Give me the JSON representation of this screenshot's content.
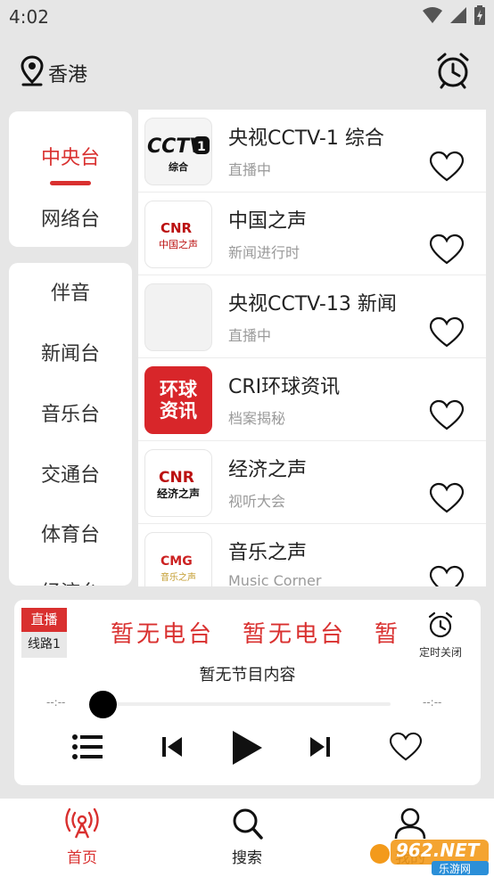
{
  "status_bar": {
    "time": "4:02"
  },
  "header": {
    "location": "香港"
  },
  "categories": {
    "group1": [
      {
        "label": "中央台",
        "active": true
      },
      {
        "label": "网络台",
        "active": false
      }
    ],
    "group2": [
      {
        "label": "伴音"
      },
      {
        "label": "新闻台"
      },
      {
        "label": "音乐台"
      },
      {
        "label": "交通台"
      },
      {
        "label": "体育台"
      },
      {
        "label": "经济台"
      }
    ]
  },
  "stations": [
    {
      "name": "央视CCTV-1 综合",
      "sub": "直播中",
      "logo": "cctv1",
      "logo_text": "综合"
    },
    {
      "name": "中国之声",
      "sub": "新闻进行时",
      "logo": "cnr-voice",
      "logo_text": "中国之声"
    },
    {
      "name": "央视CCTV-13 新闻",
      "sub": "直播中",
      "logo": "blank",
      "logo_text": ""
    },
    {
      "name": "CRI环球资讯",
      "sub": "档案揭秘",
      "logo": "cri",
      "logo_text": "环球资讯"
    },
    {
      "name": "经济之声",
      "sub": "视听大会",
      "logo": "cnr-economy",
      "logo_text": "经济之声"
    },
    {
      "name": "音乐之声",
      "sub": "Music Corner",
      "logo": "cmg",
      "logo_text": "音乐之声"
    }
  ],
  "player": {
    "live_label": "直播",
    "line_label": "线路1",
    "marquee": [
      "暂无电台",
      "暂无电台",
      "暂无电台"
    ],
    "timer_label": "定时关闭",
    "program": "暂无节目内容",
    "time_start": "--:--",
    "time_end": "--:--",
    "progress": 0
  },
  "nav": [
    {
      "label": "首页",
      "icon": "radio-signal-icon",
      "active": true
    },
    {
      "label": "搜索",
      "icon": "search-icon",
      "active": false
    },
    {
      "label": "我的",
      "icon": "user-icon",
      "active": false
    }
  ],
  "watermark": {
    "text": "962.NET",
    "sub": "乐游网"
  },
  "colors": {
    "accent": "#d9302f",
    "text": "#222222",
    "muted": "#9a9a9a",
    "background": "#e6e6e6"
  }
}
